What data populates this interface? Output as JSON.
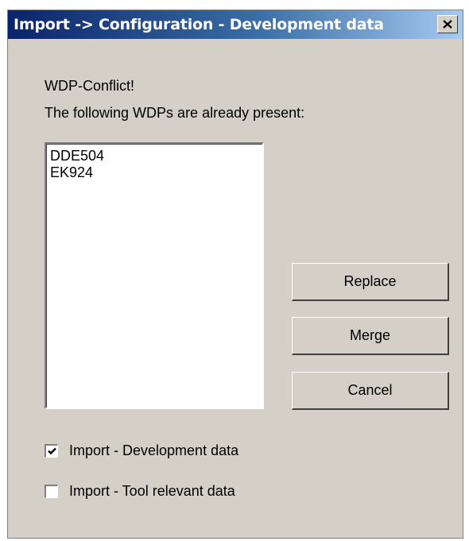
{
  "window": {
    "title": "Import -> Configuration - Development data",
    "close_icon": "close-icon"
  },
  "message": {
    "line1": "WDP-Conflict!",
    "line2": "The following WDPs are already present:"
  },
  "wdp_list": {
    "items": [
      "DDE504",
      "EK924"
    ]
  },
  "buttons": {
    "replace": "Replace",
    "merge": "Merge",
    "cancel": "Cancel"
  },
  "options": {
    "import_development": {
      "label": "Import - Development data",
      "checked": true
    },
    "import_tool_relevant": {
      "label": "Import - Tool relevant data",
      "checked": false
    }
  },
  "colors": {
    "title_bar_start": "#0a246a",
    "title_bar_end": "#a6caf0",
    "dialog_face": "#d4d0c8"
  }
}
